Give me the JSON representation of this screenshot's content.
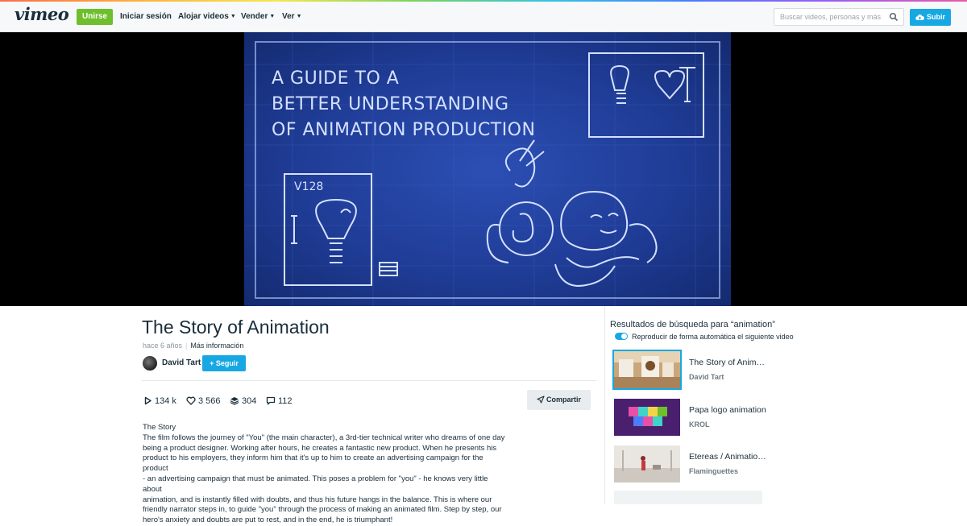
{
  "header": {
    "logo": "vimeo",
    "join_label": "Unirse",
    "login_label": "Iniciar sesión",
    "nav": [
      {
        "label": "Alojar videos"
      },
      {
        "label": "Vender"
      },
      {
        "label": "Ver"
      }
    ],
    "search_placeholder": "Buscar videos, personas y más",
    "upload_label": "Subir"
  },
  "video_frame": {
    "lines": [
      "A GUIDE TO A",
      "BETTER UNDERSTANDING",
      "OF ANIMATION PRODUCTION"
    ],
    "scene_label": "V128"
  },
  "video": {
    "title": "The Story of Animation",
    "age": "hace 6 años",
    "more_info": "Más información",
    "author": "David Tart",
    "follow_label": "+ Seguir",
    "stats": {
      "plays": "134 k",
      "likes": "3 566",
      "collections": "304",
      "comments": "112"
    },
    "share_label": "Compartir",
    "description_heading": "The Story",
    "description_lines": [
      "The film follows the journey of \"You\" (the main character), a 3rd-tier technical writer who dreams of one day",
      "being a product designer. Working after hours, he creates a fantastic new product. When he presents his",
      "product to his employers, they inform him that it's up to him to create an advertising campaign for the product",
      "- an advertising campaign that must be animated. This poses a problem for \"you\" - he knows very little about",
      "animation, and is instantly filled with doubts, and thus his future hangs in the balance. This is where our",
      "friendly narrator steps in, to guide \"you\" through the process of making an animated film. Step by step, our",
      "hero's anxiety and doubts are put to rest, and in the end, he is triumphant!"
    ]
  },
  "sidebar": {
    "results_title": "Resultados de búsqueda para “animation”",
    "autoplay_label": "Reproducir de forma automática el siguiente video",
    "items": [
      {
        "title": "The Story of Anim…",
        "author": "David Tart"
      },
      {
        "title": "Papa logo animation",
        "author": "KROL"
      },
      {
        "title": "Etereas / Animatio…",
        "author": "Flaminguettes"
      }
    ]
  },
  "colors": {
    "brand_green": "#6fbf2d",
    "accent_blue": "#17a8e3",
    "text_dark": "#1a2e3b",
    "blueprint": "#1f3c96"
  }
}
